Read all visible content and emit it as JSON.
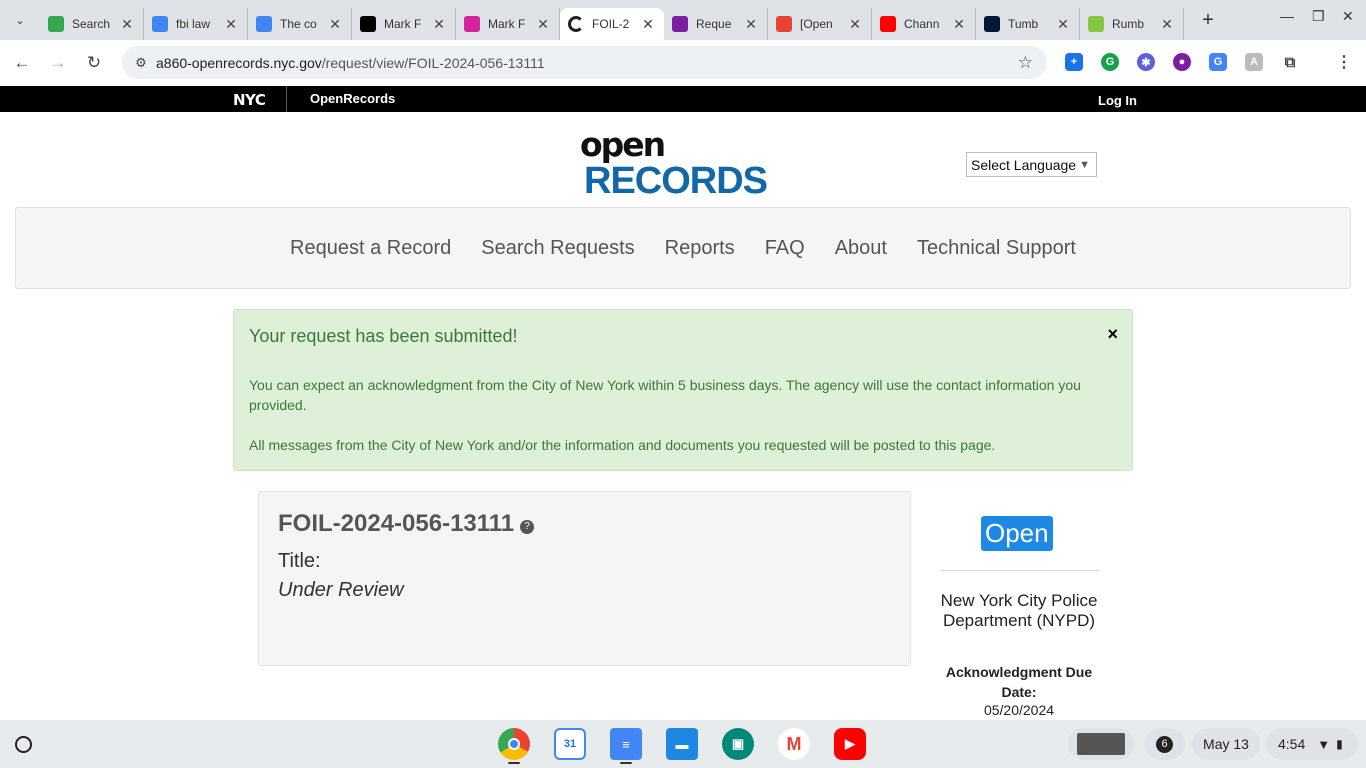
{
  "browser": {
    "tabs": [
      {
        "title": "Search",
        "color": "#34a853",
        "icon": "google-drive-icon"
      },
      {
        "title": "fbi law",
        "color": "#4285f4",
        "icon": "google-docs-icon"
      },
      {
        "title": "The co",
        "color": "#4285f4",
        "icon": "google-docs-icon"
      },
      {
        "title": "Mark F",
        "color": "#000000",
        "icon": "x-icon"
      },
      {
        "title": "Mark F",
        "color": "#d6249f",
        "icon": "instagram-icon"
      },
      {
        "title": "FOIL-2",
        "color": "#ffffff",
        "icon": "loading-icon",
        "active": true
      },
      {
        "title": "Reque",
        "color": "#7b1fa2",
        "icon": "chrome-icon"
      },
      {
        "title": "[Open",
        "color": "#ea4335",
        "icon": "gmail-icon"
      },
      {
        "title": "Chann",
        "color": "#ff0000",
        "icon": "youtube-icon"
      },
      {
        "title": "Tumb",
        "color": "#001935",
        "icon": "tumblr-icon"
      },
      {
        "title": "Rumb",
        "color": "#85c742",
        "icon": "rumble-icon"
      }
    ],
    "url_host": "a860-openrecords.nyc.gov",
    "url_path": "/request/view/FOIL-2024-056-13111"
  },
  "topbar": {
    "logo": "NYC",
    "app_name": "OpenRecords",
    "login": "Log In"
  },
  "logo": {
    "open": "open",
    "records": "RECORDS"
  },
  "language": {
    "label": "Select Language"
  },
  "nav": {
    "items": [
      "Request a Record",
      "Search Requests",
      "Reports",
      "FAQ",
      "About",
      "Technical Support"
    ]
  },
  "alert": {
    "heading": "Your request has been submitted!",
    "line1": "You can expect an acknowledgment from the City of New York within 5 business days. The agency will use the contact information you provided.",
    "line2": "All messages from the City of New York and/or the information and documents you requested will be posted to this page.",
    "close": "×"
  },
  "request": {
    "id": "FOIL-2024-056-13111",
    "title_label": "Title:",
    "title_value": "Under Review"
  },
  "sidebar": {
    "status": "Open",
    "agency": "New York City Police Department (NYPD)",
    "ack_label": "Acknowledgment Due Date:",
    "ack_date": "05/20/2024"
  },
  "shelf": {
    "notification_count": "6",
    "date": "May 13",
    "time": "4:54"
  },
  "colors": {
    "alert_bg": "#dff0d8",
    "alert_text": "#3c763d",
    "status_blue": "#1e88e5",
    "records_blue": "#1167a8"
  }
}
